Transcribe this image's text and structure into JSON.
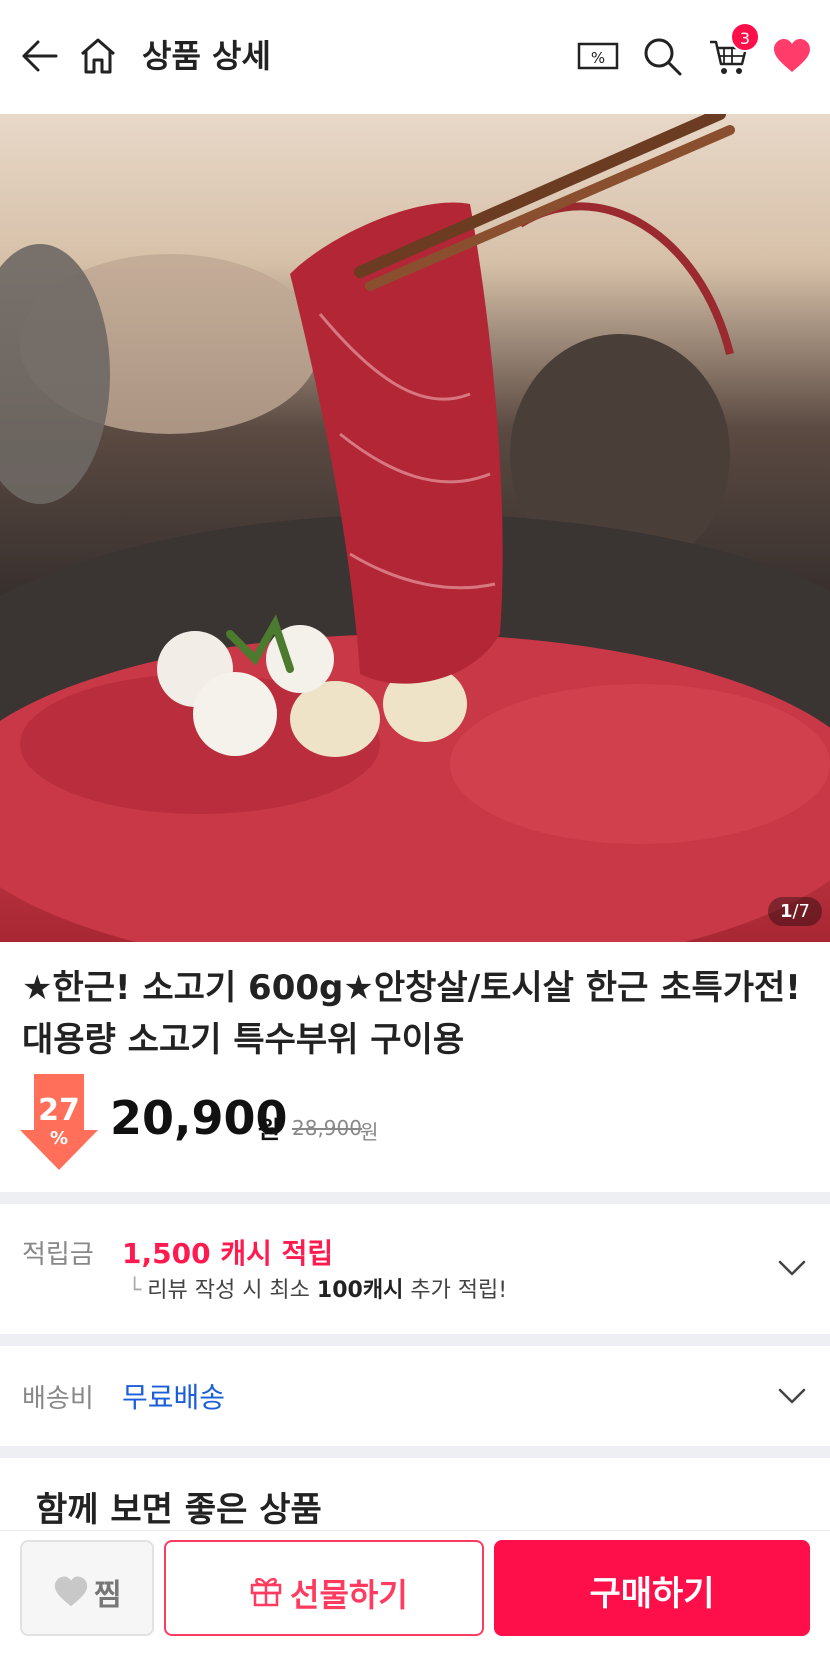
{
  "header": {
    "title": "상품 상세",
    "cart_count": "3",
    "icons": [
      "back-arrow-icon",
      "home-icon",
      "coupon-icon",
      "search-icon",
      "cart-icon",
      "heart-icon"
    ]
  },
  "hero": {
    "image_index": "1",
    "image_total": "/7"
  },
  "product": {
    "title": "★한근! 소고기 600g★안창살/토시살 한근 초특가전! 대용량 소고기 특수부위 구이용",
    "discount_percent": "27",
    "discount_symbol": "%",
    "price": "20,900",
    "price_unit": "원",
    "original_price": "28,900",
    "original_unit": "원"
  },
  "points": {
    "label": "적립금",
    "value": "1,500 캐시 적립",
    "sub_prefix": "리뷰 작성 시 최소",
    "sub_bold": "100캐시",
    "sub_suffix": "추가 적립!"
  },
  "shipping": {
    "label": "배송비",
    "value": "무료배송"
  },
  "related": {
    "title": "함께 보면 좋은 상품"
  },
  "bottom_bar": {
    "like_label": "찜",
    "gift_label": "선물하기",
    "buy_label": "구매하기"
  },
  "colors": {
    "accent": "#ff0f4a",
    "shipping_blue": "#1a5fd8",
    "points_red": "#ff1a4f",
    "discount_arrow": "#ff6f5a"
  }
}
